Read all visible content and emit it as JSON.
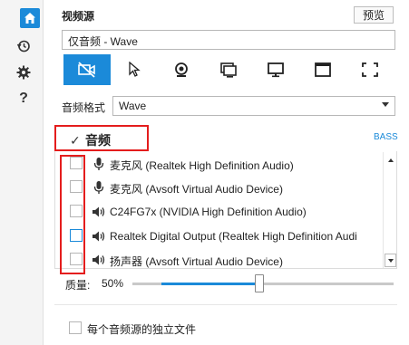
{
  "sidebar": {
    "items": [
      {
        "icon": "home-icon"
      },
      {
        "icon": "history-icon"
      },
      {
        "icon": "gear-icon"
      },
      {
        "icon": "help-icon",
        "label": "?"
      }
    ],
    "accent": "#1b8ad9"
  },
  "source": {
    "label": "视频源",
    "preview_label": "预览",
    "value": "仅音频 - Wave"
  },
  "toolbar": {
    "tools": [
      {
        "icon": "no-video-icon",
        "active": true
      },
      {
        "icon": "cursor-icon",
        "active": false
      },
      {
        "icon": "webcam-icon",
        "active": false
      },
      {
        "icon": "windows-icon",
        "active": false
      },
      {
        "icon": "monitor-icon",
        "active": false
      },
      {
        "icon": "window-icon",
        "active": false
      },
      {
        "icon": "region-icon",
        "active": false
      }
    ]
  },
  "format": {
    "label": "音频格式",
    "value": "Wave"
  },
  "audio": {
    "title": "音频",
    "checked": true,
    "bass_label": "BASS",
    "devices": [
      {
        "icon": "microphone-icon",
        "name": "麦克风 (Realtek High Definition Audio)",
        "checked": false
      },
      {
        "icon": "microphone-icon",
        "name": "麦克风 (Avsoft Virtual Audio Device)",
        "checked": false
      },
      {
        "icon": "speaker-icon",
        "name": "C24FG7x (NVIDIA High Definition Audio)",
        "checked": false
      },
      {
        "icon": "speaker-icon",
        "name": "Realtek Digital Output (Realtek High Definition Audi",
        "checked": false
      },
      {
        "icon": "speaker-icon",
        "name": "扬声器 (Avsoft Virtual Audio Device)",
        "checked": false
      }
    ]
  },
  "quality": {
    "label": "质量:",
    "value_label": "50%",
    "value": 0.5
  },
  "independent_file": {
    "label": "每个音频源的独立文件",
    "checked": false
  },
  "colors": {
    "accent": "#1b8ad9",
    "highlight_box": "#e41d1d"
  }
}
